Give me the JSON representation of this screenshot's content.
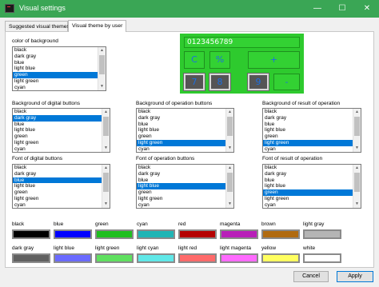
{
  "window": {
    "title": "Visual settings",
    "minimize": "—",
    "maximize": "☐",
    "close": "✕",
    "titlebar_color": "#3aa655"
  },
  "tabs": [
    {
      "label": "Suggested visual themes"
    },
    {
      "label": "Visual theme by user"
    }
  ],
  "color_lists": {
    "background": {
      "label": "color of background",
      "items": [
        "black",
        "dark gray",
        "blue",
        "light blue",
        "green",
        "light green",
        "cyan"
      ],
      "selected": 4
    },
    "bg_digital": {
      "label": "Background of digital buttons",
      "items": [
        "black",
        "dark gray",
        "blue",
        "light blue",
        "green",
        "light green",
        "cyan"
      ],
      "selected": 1
    },
    "bg_operation": {
      "label": "Background of operation buttons",
      "items": [
        "black",
        "dark gray",
        "blue",
        "light blue",
        "green",
        "light green",
        "cyan"
      ],
      "selected": 5
    },
    "bg_result": {
      "label": "Background of result of operation",
      "items": [
        "black",
        "dark gray",
        "blue",
        "light blue",
        "green",
        "light green",
        "cyan"
      ],
      "selected": 5
    },
    "font_digital": {
      "label": "Font of digital buttons",
      "items": [
        "black",
        "dark gray",
        "blue",
        "light blue",
        "green",
        "light green",
        "cyan"
      ],
      "selected": 2
    },
    "font_operation": {
      "label": "Font of operation buttons",
      "items": [
        "black",
        "dark gray",
        "blue",
        "light blue",
        "green",
        "light green",
        "cyan"
      ],
      "selected": 3
    },
    "font_result": {
      "label": "Font of result of operation",
      "items": [
        "black",
        "dark gray",
        "blue",
        "light blue",
        "green",
        "light green",
        "cyan"
      ],
      "selected": 4
    }
  },
  "preview": {
    "display": "0123456789",
    "op_buttons": [
      "C",
      "%",
      "+"
    ],
    "digit_buttons": [
      "7",
      "8",
      "9"
    ],
    "minus": "-"
  },
  "swatches": [
    {
      "label": "black",
      "color": "#000000"
    },
    {
      "label": "blue",
      "color": "#0000ff"
    },
    {
      "label": "green",
      "color": "#1fbf1f"
    },
    {
      "label": "cyan",
      "color": "#1fb5b5"
    },
    {
      "label": "red",
      "color": "#b50000"
    },
    {
      "label": "magenta",
      "color": "#b81fb8"
    },
    {
      "label": "brown",
      "color": "#b06a10"
    },
    {
      "label": "light gray",
      "color": "#b5b5b5"
    },
    {
      "label": "dark gray",
      "color": "#606060"
    },
    {
      "label": "light blue",
      "color": "#6a6aff"
    },
    {
      "label": "light green",
      "color": "#5fe05f"
    },
    {
      "label": "light cyan",
      "color": "#5fe8e8"
    },
    {
      "label": "light red",
      "color": "#ff6a6a"
    },
    {
      "label": "light magenta",
      "color": "#ff6aff"
    },
    {
      "label": "yellow",
      "color": "#ffff5f"
    },
    {
      "label": "white",
      "color": "#ffffff"
    }
  ],
  "footer": {
    "cancel": "Cancel",
    "apply": "Apply"
  }
}
